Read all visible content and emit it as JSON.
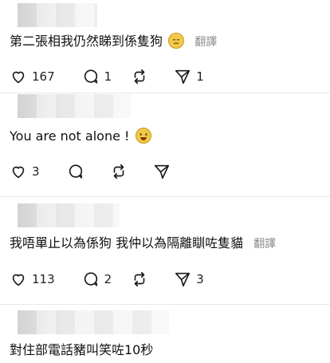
{
  "comments": [
    {
      "text": "第二張相我仍然睇到係隻狗",
      "emoji": "disappointed-face",
      "translate": "翻譯",
      "likes": "167",
      "replies": "1",
      "reposts": "",
      "shares": "1"
    },
    {
      "text": "You are not alone !",
      "emoji": "laughing-face",
      "translate": "",
      "likes": "3",
      "replies": "",
      "reposts": "",
      "shares": ""
    },
    {
      "text": "我唔單止以為係狗 我仲以為隔離瞓咗隻貓",
      "emoji": "",
      "translate": "翻譯",
      "likes": "113",
      "replies": "2",
      "reposts": "",
      "shares": "3"
    },
    {
      "text": "對住部電話豬叫笑咗10秒",
      "emoji": "",
      "translate": "",
      "likes": "",
      "replies": "",
      "reposts": "",
      "shares": ""
    }
  ],
  "colors": {
    "icon": "#1a1a1a",
    "muted": "#8a8a8a",
    "divider": "#e7e7e7"
  }
}
